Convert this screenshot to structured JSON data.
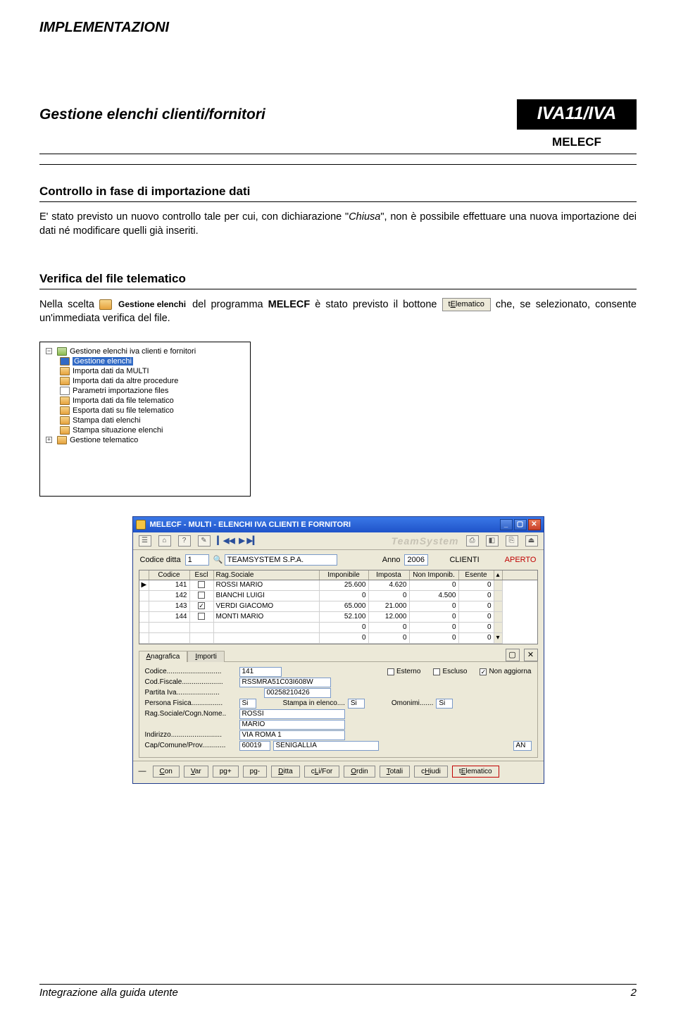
{
  "page": {
    "implementazioni": "IMPLEMENTAZIONI",
    "subtitle": "Gestione elenchi clienti/fornitori",
    "badge": "IVA11/IVA",
    "code": "MELECF",
    "footer_left": "Integrazione alla guida utente",
    "footer_right": "2"
  },
  "sec1": {
    "title": "Controllo in fase di importazione dati",
    "body_a": "E' stato previsto un nuovo controllo tale per cui, con dichiarazione \"",
    "body_i": "Chiusa",
    "body_b": "\", non è possibile effettuare una nuova importazione dei dati né modificare quelli già inseriti."
  },
  "sec2": {
    "title": "Verifica del file telematico",
    "p_a": "Nella scelta ",
    "icon_label": "Gestione elenchi",
    "p_b": " del programma ",
    "prog": "MELECF",
    "p_c": " è stato previsto il bottone ",
    "btn": "tElematico",
    "p_d": " che, se selezionato, consente un'immediata verifica del file.",
    "btn_prefix": "t",
    "btn_under": "E",
    "btn_suffix": "lematico"
  },
  "tree": {
    "root": "Gestione elenchi iva clienti e fornitori",
    "items": [
      "Gestione elenchi",
      "Importa dati da MULTI",
      "Importa dati da altre procedure",
      "Parametri importazione files",
      "Importa dati da file telematico",
      "Esporta dati su file telematico",
      "Stampa dati elenchi",
      "Stampa situazione elenchi",
      "Gestione telematico"
    ]
  },
  "app": {
    "title": "MELECF  - MULTI -  ELENCHI IVA CLIENTI E FORNITORI",
    "logo": "TeamSystem",
    "codice_ditta_lbl": "Codice ditta",
    "codice_ditta": "1",
    "ditta_name": "TEAMSYSTEM S.P.A.",
    "anno_lbl": "Anno",
    "anno": "2006",
    "clienti": "CLIENTI",
    "aperto": "APERTO",
    "headers": [
      "",
      "Codice",
      "Escl",
      "Rag.Sociale",
      "Imponibile",
      "Imposta",
      "Non Imponib.",
      "Esente",
      ""
    ],
    "rows": [
      {
        "mk": "▶",
        "codice": "141",
        "escl": false,
        "rag": "ROSSI MARIO",
        "imp": "25.600",
        "imposta": "4.620",
        "non": "0",
        "es": "0"
      },
      {
        "mk": "",
        "codice": "142",
        "escl": false,
        "rag": "BIANCHI LUIGI",
        "imp": "0",
        "imposta": "0",
        "non": "4.500",
        "es": "0"
      },
      {
        "mk": "",
        "codice": "143",
        "escl": true,
        "rag": "VERDI GIACOMO",
        "imp": "65.000",
        "imposta": "21.000",
        "non": "0",
        "es": "0"
      },
      {
        "mk": "",
        "codice": "144",
        "escl": false,
        "rag": "MONTI MARIO",
        "imp": "52.100",
        "imposta": "12.000",
        "non": "0",
        "es": "0"
      },
      {
        "mk": "",
        "codice": "",
        "escl": null,
        "rag": "",
        "imp": "0",
        "imposta": "0",
        "non": "0",
        "es": "0"
      },
      {
        "mk": "",
        "codice": "",
        "escl": null,
        "rag": "",
        "imp": "0",
        "imposta": "0",
        "non": "0",
        "es": "0"
      }
    ],
    "tabs": {
      "anag": "Anagrafica",
      "imp": "Importi"
    },
    "detail": {
      "codice_lbl": "Codice",
      "codice": "141",
      "esterno": "Esterno",
      "escluso": "Escluso",
      "nonagg": "Non aggiorna",
      "cf_lbl": "Cod.Fiscale",
      "cf": "RSSMRA51C03I608W",
      "piva_lbl": "Partita Iva",
      "piva": "00258210426",
      "pf_lbl": "Persona Fisica",
      "pf": "Si",
      "stampa_lbl": "Stampa in elenco....",
      "stampa": "Si",
      "omon_lbl": "Omonimi.......",
      "omon": "Si",
      "rag_lbl": "Rag.Sociale/Cogn.Nome",
      "rag1": "ROSSI",
      "rag2": "MARIO",
      "ind_lbl": "Indirizzo",
      "ind": "VIA ROMA 1",
      "cap_lbl": "Cap/Comune/Prov",
      "cap": "60019",
      "com": "SENIGALLIA",
      "prov": "AN"
    },
    "buttons": [
      "Con",
      "Var",
      "pg+",
      "pg-",
      "Ditta",
      "cLi/For",
      "Ordin",
      "Totali",
      "cHiudi",
      "tElematico"
    ],
    "btn_under": [
      "C",
      "V",
      "",
      "",
      "D",
      "L",
      "O",
      "T",
      "H",
      "E"
    ]
  }
}
